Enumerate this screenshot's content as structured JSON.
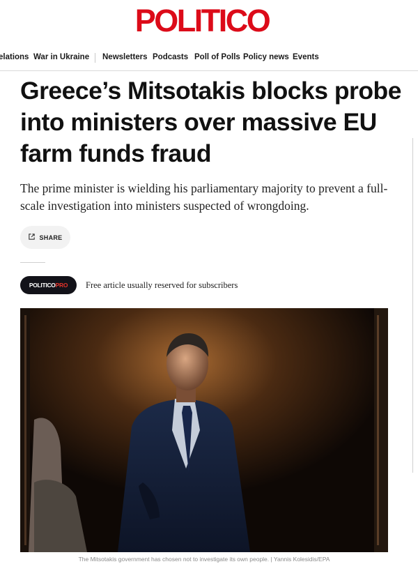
{
  "brand": {
    "logo_text": "POLITICO",
    "logo_color": "#dc0b19"
  },
  "nav": {
    "items": [
      "elations",
      "War in Ukraine",
      "Newsletters",
      "Podcasts",
      "Poll of Polls",
      "Policy news",
      "Events"
    ]
  },
  "article": {
    "headline": "Greece’s Mitsotakis blocks probe into ministers over massive EU farm funds fraud",
    "dek": "The prime minister is wielding his parliamentary majority to prevent a full-scale investigation into ministers suspected of wrongdoing.",
    "share_label": "SHARE",
    "pro_badge": {
      "part1": "POLITICO",
      "part2": "PRO"
    },
    "free_text": "Free article usually reserved for subscribers",
    "image": {
      "icon": "photo-of-prime-minister"
    },
    "caption": "The Mitsotakis government has chosen not to investigate its own people. | Yannis Kolesidis/EPA"
  }
}
